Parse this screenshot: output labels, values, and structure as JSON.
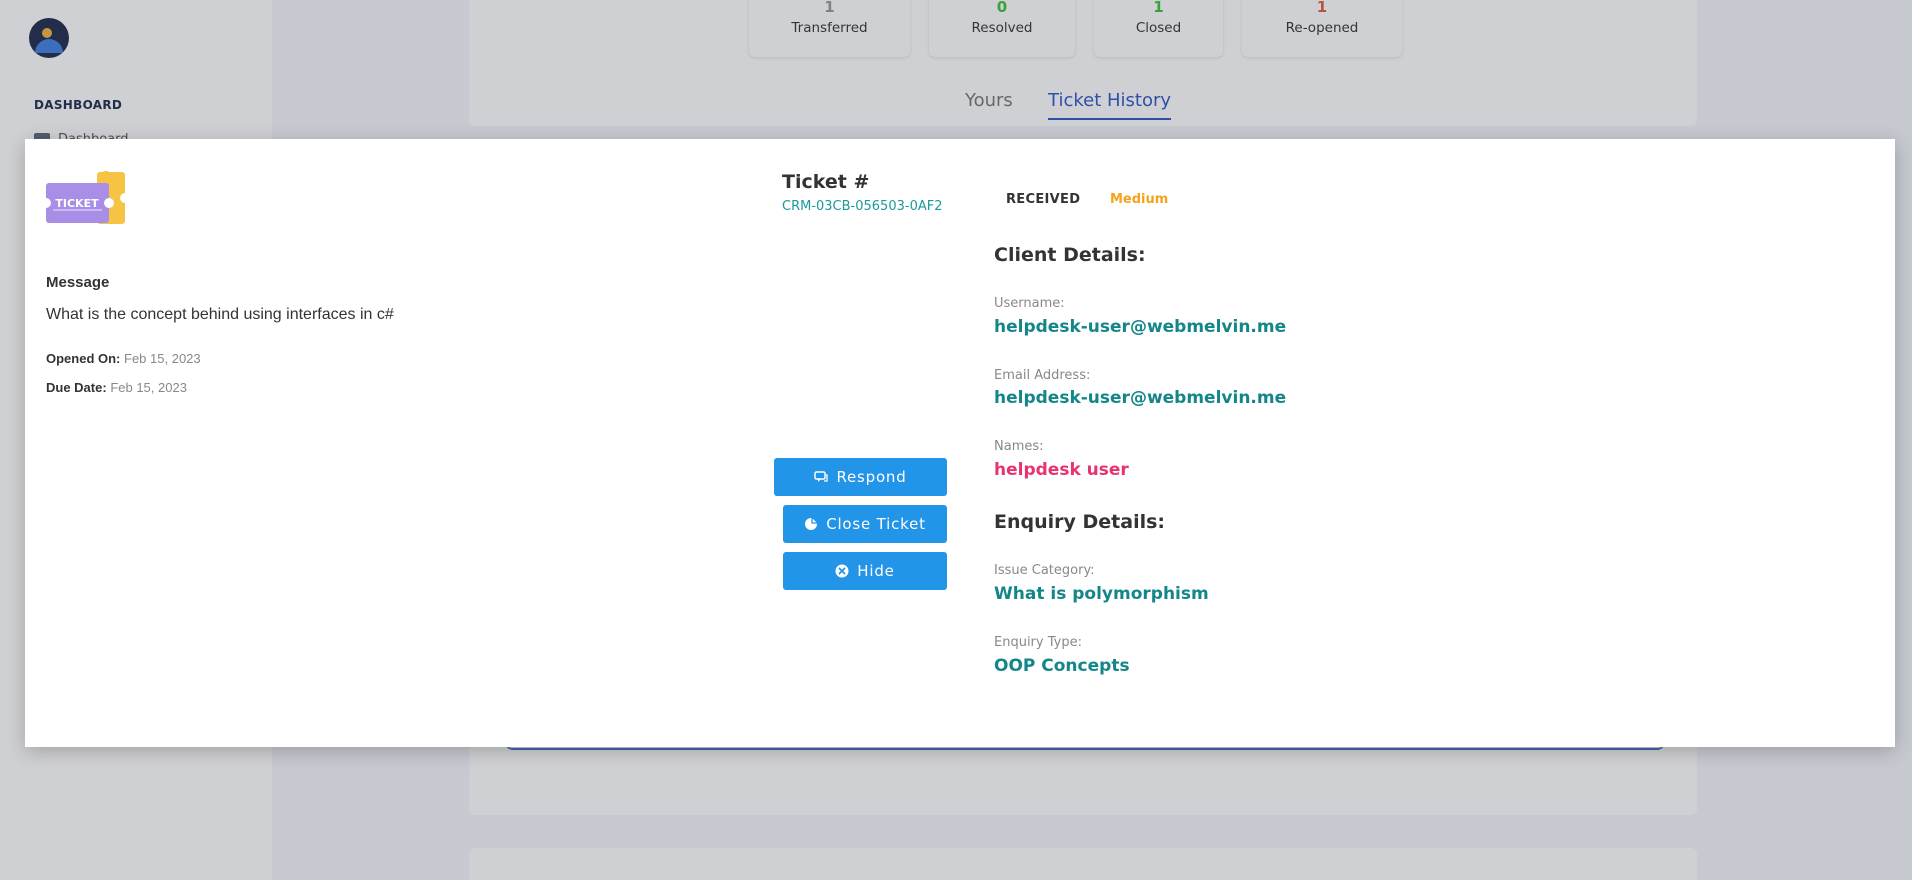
{
  "sidebar": {
    "heading": "DASHBOARD",
    "item_label": "Dashboard"
  },
  "stats": [
    {
      "count": "1",
      "label": "Transferred",
      "color": "#999999"
    },
    {
      "count": "0",
      "label": "Resolved",
      "color": "#3cc23c"
    },
    {
      "count": "1",
      "label": "Closed",
      "color": "#3cc23c"
    },
    {
      "count": "1",
      "label": "Re-opened",
      "color": "#e8583a"
    }
  ],
  "tabs": {
    "yours": "Yours",
    "history": "Ticket History"
  },
  "modal": {
    "ticket_art_text": "TICKET",
    "message_label": "Message",
    "message": "What is the concept behind using interfaces in c#",
    "opened_label": "Opened On:",
    "opened_value": "Feb 15, 2023",
    "due_label": "Due Date:",
    "due_value": "Feb 15, 2023",
    "ticket_title": "Ticket #",
    "ticket_id": "CRM-03CB-056503-0AF2",
    "status": "RECEIVED",
    "priority": "Medium",
    "buttons": {
      "respond": "Respond",
      "close": "Close Ticket",
      "hide": "Hide"
    },
    "client": {
      "title": "Client Details:",
      "username_label": "Username:",
      "username": "helpdesk-user@webmelvin.me",
      "email_label": "Email Address:",
      "email": "helpdesk-user@webmelvin.me",
      "names_label": "Names:",
      "names": "helpdesk user"
    },
    "enquiry": {
      "title": "Enquiry Details:",
      "category_label": "Issue Category:",
      "category": "What is polymorphism",
      "type_label": "Enquiry Type:",
      "type": "OOP Concepts"
    }
  },
  "colors": {
    "accent_button": "#2295e9",
    "teal_value": "#14868a",
    "pink_value": "#e8336e",
    "priority_medium": "#f5a31a",
    "tab_active": "#2f56c8"
  }
}
